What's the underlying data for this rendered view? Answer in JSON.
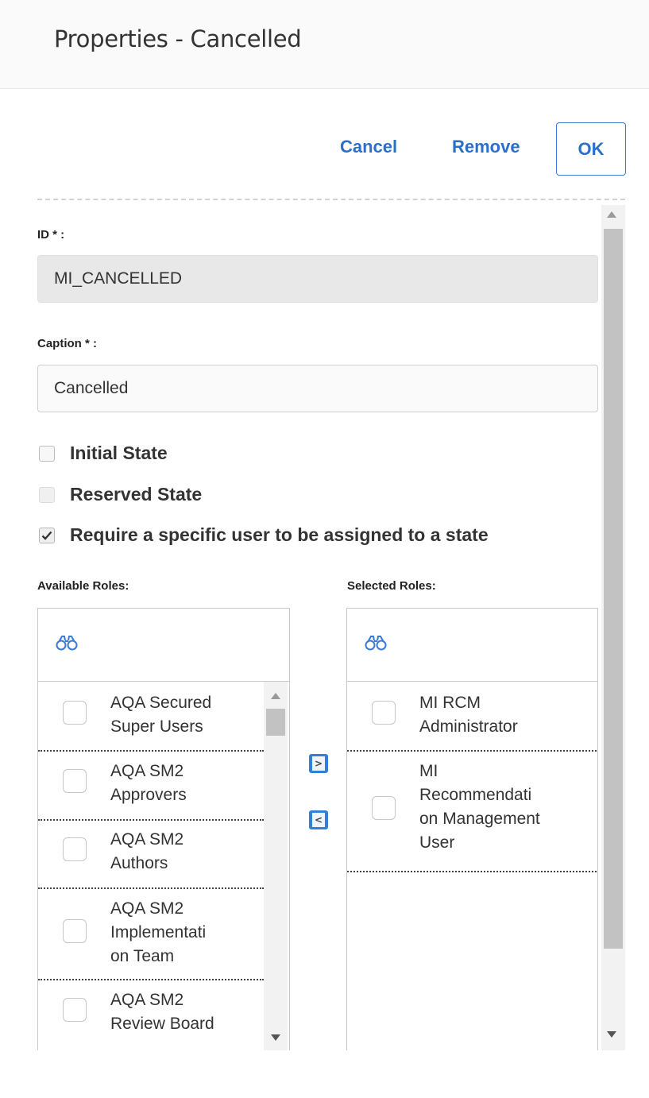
{
  "header": {
    "title": "Properties - Cancelled"
  },
  "actions": {
    "cancel": "Cancel",
    "remove": "Remove",
    "ok": "OK"
  },
  "fields": {
    "id_label": "ID * :",
    "id_value": "MI_CANCELLED",
    "caption_label": "Caption * :",
    "caption_value": "Cancelled"
  },
  "options": {
    "initial_state": {
      "label": "Initial State",
      "checked": false
    },
    "reserved_state": {
      "label": "Reserved State",
      "checked": false,
      "disabled": true
    },
    "require_user": {
      "label": "Require a specific user to be assigned to a state",
      "checked": true
    }
  },
  "roles": {
    "available_label": "Available Roles:",
    "selected_label": "Selected Roles:",
    "available": [
      {
        "l1": "AQA Secured",
        "l2": "Super Users",
        "l3": ""
      },
      {
        "l1": "AQA SM2",
        "l2": "Approvers",
        "l3": ""
      },
      {
        "l1": "AQA SM2",
        "l2": "Authors",
        "l3": ""
      },
      {
        "l1": "AQA SM2",
        "l2": "Implementati",
        "l3": "on Team"
      },
      {
        "l1": "AQA SM2",
        "l2": "Review Board",
        "l3": ""
      }
    ],
    "selected": [
      {
        "l1": "MI RCM",
        "l2": "Administrator",
        "l3": "",
        "l4": ""
      },
      {
        "l1": "MI",
        "l2": "Recommendati",
        "l3": "on Management",
        "l4": "User"
      }
    ],
    "move_right": ">",
    "move_left": "<"
  },
  "colors": {
    "accent": "#2a6fc9",
    "button_blue": "#2f80d8"
  }
}
